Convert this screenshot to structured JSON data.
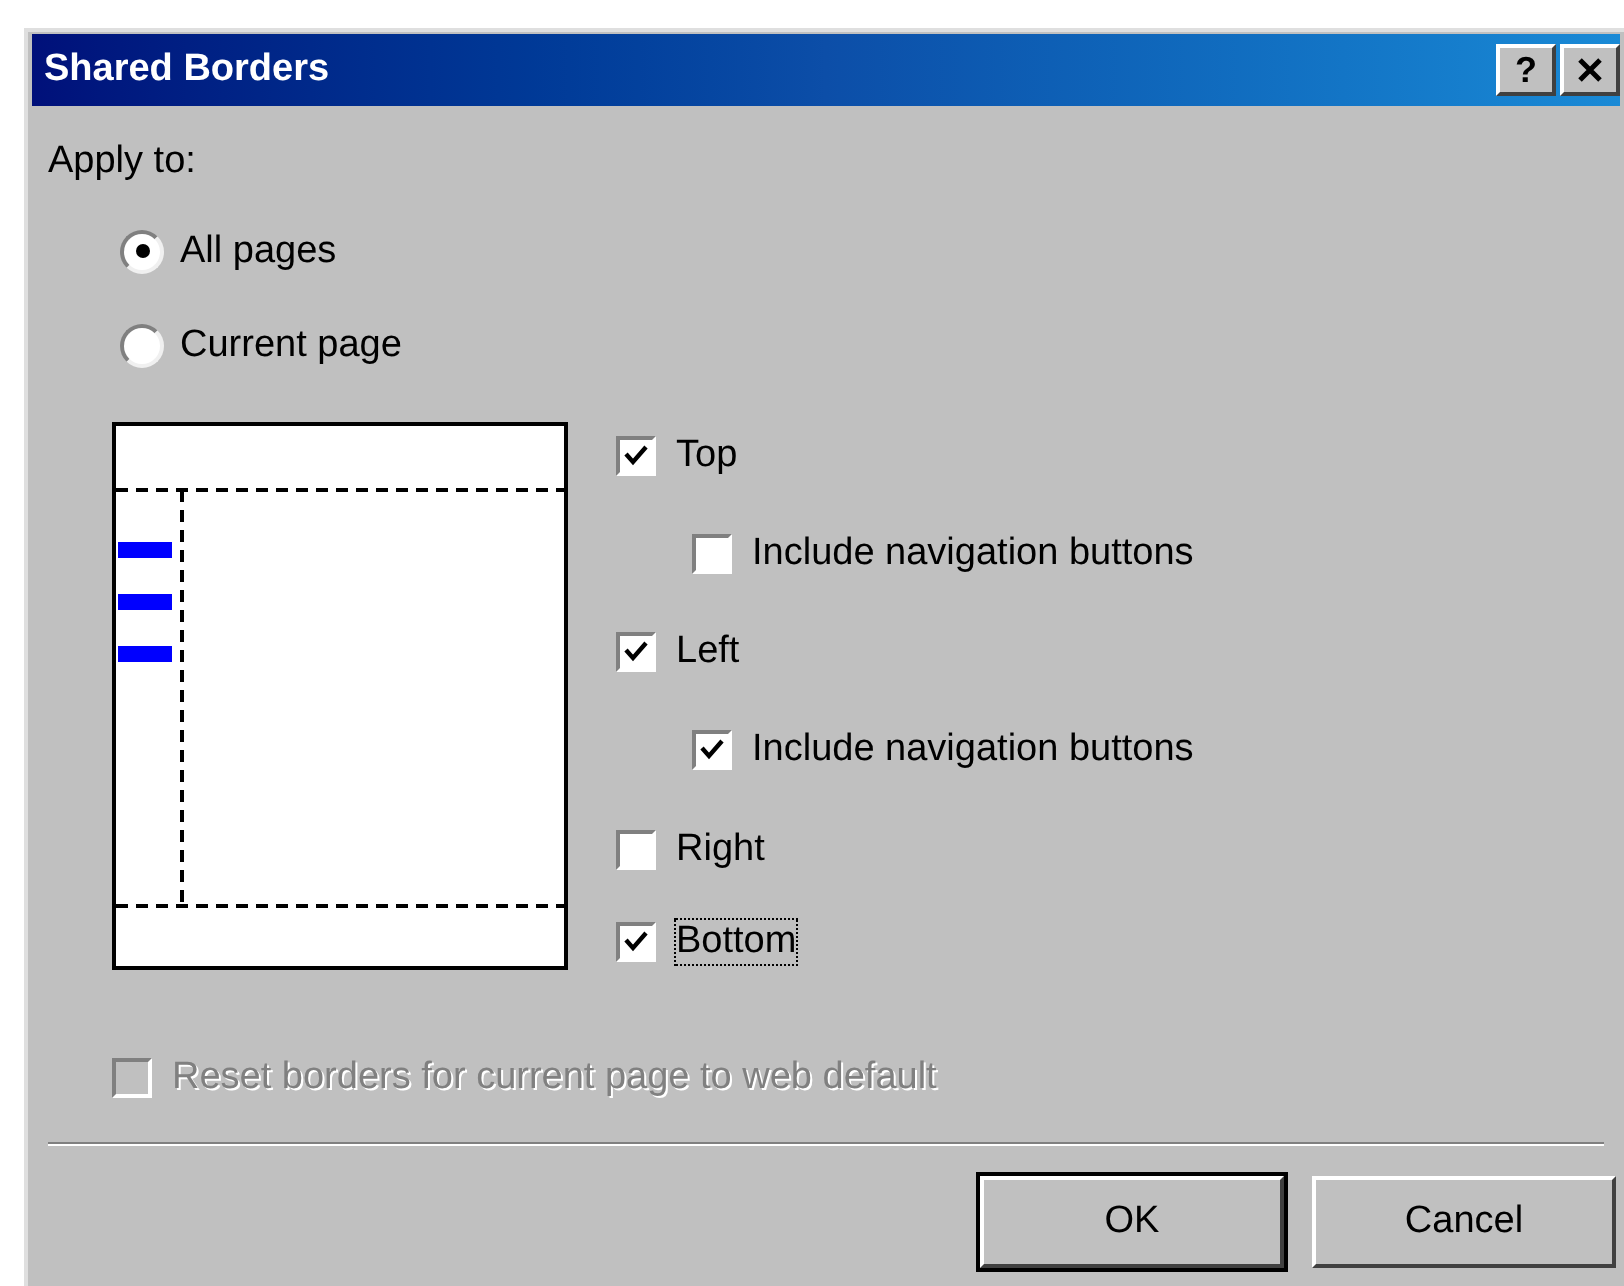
{
  "window": {
    "title": "Shared Borders",
    "help_button": "?"
  },
  "apply_to": {
    "label": "Apply to:",
    "options": [
      {
        "label": "All pages",
        "selected": true
      },
      {
        "label": "Current page",
        "selected": false
      }
    ]
  },
  "borders": [
    {
      "label": "Top",
      "checked": true,
      "focused": false,
      "children": [
        {
          "label": "Include navigation buttons",
          "checked": false
        }
      ]
    },
    {
      "label": "Left",
      "checked": true,
      "focused": false,
      "children": [
        {
          "label": "Include navigation buttons",
          "checked": true
        }
      ]
    },
    {
      "label": "Right",
      "checked": false,
      "focused": false
    },
    {
      "label": "Bottom",
      "checked": true,
      "focused": true
    }
  ],
  "reset": {
    "label": "Reset borders for current page to web default",
    "checked": false,
    "disabled": true
  },
  "buttons": [
    {
      "label": "OK",
      "default": true
    },
    {
      "label": "Cancel",
      "default": false
    }
  ]
}
